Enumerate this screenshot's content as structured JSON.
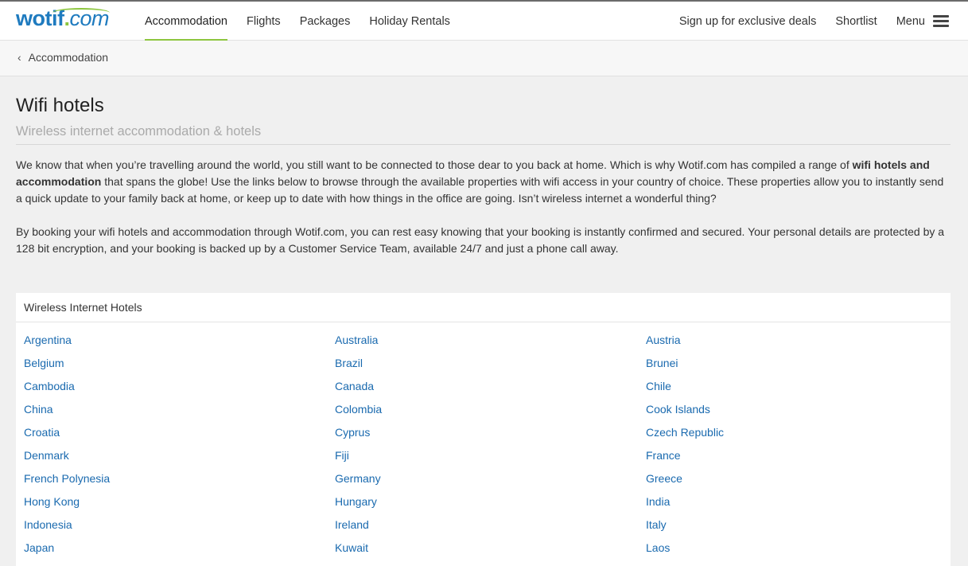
{
  "header": {
    "logo": {
      "name": "wotif",
      "dot": ".",
      "tld": "com"
    },
    "nav": [
      "Accommodation",
      "Flights",
      "Packages",
      "Holiday Rentals"
    ],
    "right": {
      "deals": "Sign up for exclusive deals",
      "shortlist": "Shortlist",
      "menu": "Menu"
    },
    "accent_color": "#8dc63f",
    "brand_color": "#1f7bbf"
  },
  "breadcrumb": {
    "label": "Accommodation",
    "icon": "chevron-left-icon"
  },
  "page": {
    "title": "Wifi hotels",
    "subtitle": "Wireless internet accommodation & hotels",
    "para1": {
      "a": "We know that when you’re travelling around the world, you still want to be connected to those dear to you back at home. Which is why Wotif.com has compiled a range of ",
      "bold": "wifi hotels and accommodation",
      "b": " that spans the globe! Use the links below to browse through the available properties with wifi access in your country of choice. These properties allow you to instantly send a quick update to your family back at home, or keep up to date with how things in the office are going. Isn’t wireless internet a wonderful thing?"
    },
    "para2": "By booking your wifi hotels and accommodation through Wotif.com, you can rest easy knowing that your booking is instantly confirmed and secured. Your personal details are protected by a 128 bit encryption, and your booking is backed up by a Customer Service Team, available 24/7 and just a phone call away."
  },
  "panel": {
    "title": "Wireless Internet Hotels",
    "countries": [
      "Argentina",
      "Australia",
      "Austria",
      "Belgium",
      "Brazil",
      "Brunei",
      "Cambodia",
      "Canada",
      "Chile",
      "China",
      "Colombia",
      "Cook Islands",
      "Croatia",
      "Cyprus",
      "Czech Republic",
      "Denmark",
      "Fiji",
      "France",
      "French Polynesia",
      "Germany",
      "Greece",
      "Hong Kong",
      "Hungary",
      "India",
      "Indonesia",
      "Ireland",
      "Italy",
      "Japan",
      "Kuwait",
      "Laos"
    ],
    "link_color": "#1a6aaf"
  }
}
